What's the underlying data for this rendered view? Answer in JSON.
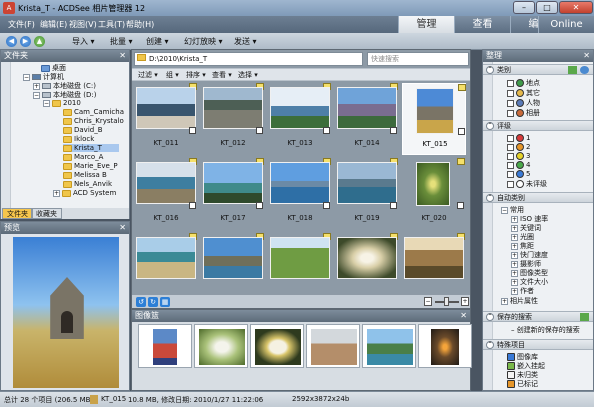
{
  "window": {
    "title": "Krista_T - ACDSee 相片管理器 12"
  },
  "menu": [
    "文件(F)",
    "编辑(E)",
    "视图(V)",
    "工具(T)",
    "帮助(H)"
  ],
  "modes": [
    "管理",
    "查看",
    "编辑",
    "Online"
  ],
  "toolbar": {
    "import": "导入",
    "batch": "批量",
    "create": "创建",
    "slideshow": "幻灯放映",
    "send": "发送"
  },
  "folders": {
    "title": "文件夹",
    "tree": [
      "桌面",
      "计算机",
      "本地磁盘 (C:)",
      "本地磁盘 (D:)",
      "2010",
      "Cam_Camicha",
      "Chris_Krystalo",
      "David_B",
      "Iklock",
      "Krista_T",
      "Marco_A",
      "Marie_Eve_P",
      "Melissa B",
      "Nels_Anvik",
      "ACD System"
    ],
    "tabs": [
      "文件夹",
      "收藏夹"
    ]
  },
  "preview": {
    "title": "预览"
  },
  "filelist": {
    "path": "D:\\2010\\Krista_T",
    "search_placeholder": "快速搜索",
    "filters": [
      "过滤",
      "组",
      "排序",
      "查看",
      "选择"
    ],
    "thumbs": [
      "KT_011",
      "KT_012",
      "KT_013",
      "KT_014",
      "KT_015",
      "KT_016",
      "KT_017",
      "KT_018",
      "KT_019",
      "KT_020"
    ]
  },
  "strip": {
    "title": "图像篮"
  },
  "organize": {
    "title": "整理",
    "categories_title": "类别",
    "categories": [
      "地点",
      "其它",
      "人物",
      "相册"
    ],
    "ratings_title": "评级",
    "ratings": [
      "1",
      "2",
      "3",
      "4",
      "5",
      "未评级"
    ],
    "auto_title": "自动类别",
    "auto_items": [
      "常用",
      "ISO 速率",
      "关键词",
      "光圈",
      "焦距",
      "快门速度",
      "摄影师",
      "图像类型",
      "文件大小",
      "作者",
      "相片属性"
    ],
    "saved_title": "保存的搜索",
    "saved_action": "创建新的保存的搜索",
    "special_title": "特殊项目",
    "special_items": [
      "图像库",
      "嵌入挂起",
      "未归类",
      "已标记"
    ]
  },
  "status": {
    "total": "总计 28 个项目 (206.5 MB)",
    "file": "KT_015",
    "info": "10.8 MB, 修改日期: 2010/1/27 11:22:06",
    "dims": "2592x3872x24b"
  },
  "colors": {
    "accent": "#f6c64c",
    "titlebar": "#8aa4c1"
  }
}
